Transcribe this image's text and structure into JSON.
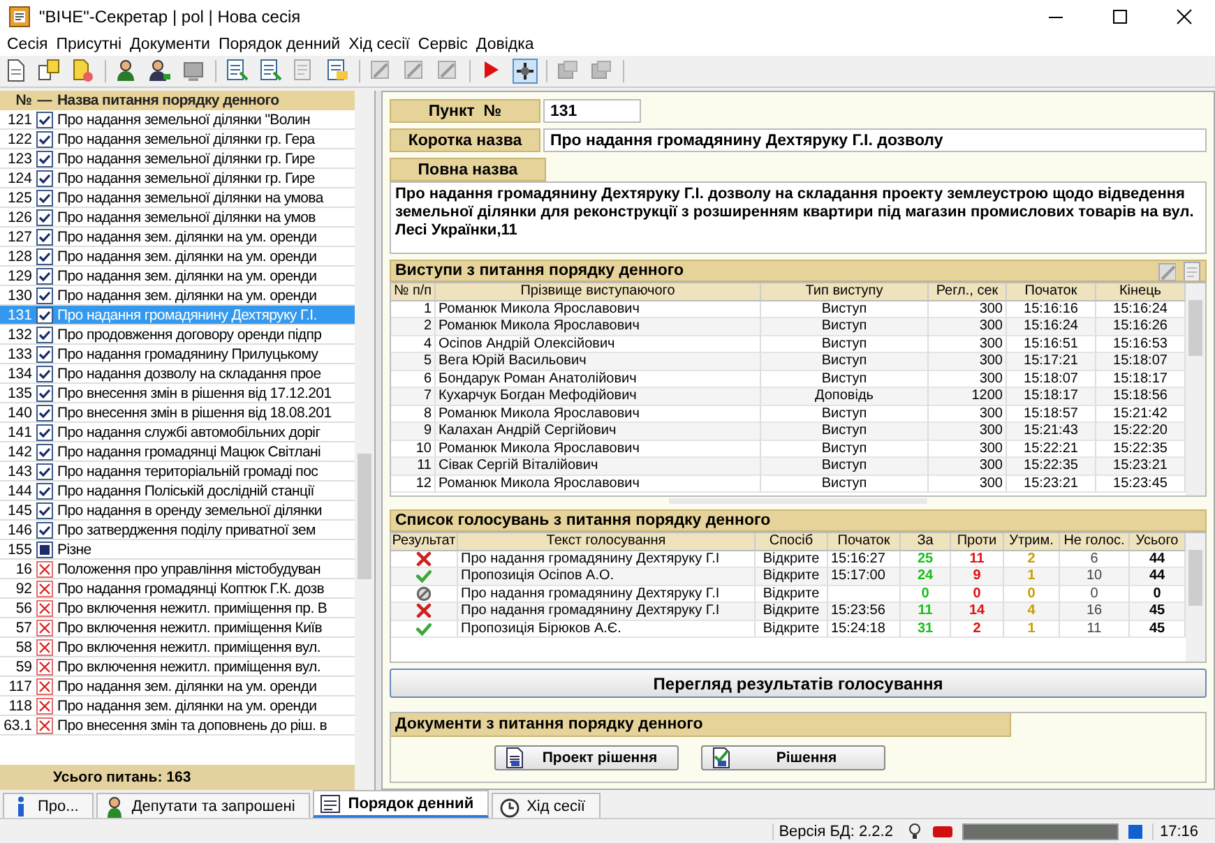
{
  "window": {
    "title": "\"ВІЧЕ\"-Секретар | pol | Нова сесія"
  },
  "menu": [
    "Сесія",
    "Присутні",
    "Документи",
    "Порядок денний",
    "Хід сесії",
    "Сервіс",
    "Довідка"
  ],
  "agenda": {
    "columns": [
      "№",
      "—",
      "Назва питання порядку денного"
    ],
    "items": [
      {
        "number": "121",
        "kind": "adopted",
        "selected": false,
        "title": "Про надання земельної ділянки \"Волин"
      },
      {
        "number": "122",
        "kind": "adopted",
        "selected": false,
        "title": "Про надання земельної ділянки гр. Гера"
      },
      {
        "number": "123",
        "kind": "adopted",
        "selected": false,
        "title": "Про надання земельної ділянки гр. Гире"
      },
      {
        "number": "124",
        "kind": "adopted",
        "selected": false,
        "title": "Про надання земельної ділянки гр. Гире"
      },
      {
        "number": "125",
        "kind": "adopted",
        "selected": false,
        "title": "Про надання земельної ділянки на умова"
      },
      {
        "number": "126",
        "kind": "adopted",
        "selected": false,
        "title": "Про надання земельної ділянки на умов"
      },
      {
        "number": "127",
        "kind": "adopted",
        "selected": false,
        "title": "Про надання зем. ділянки на ум. оренди"
      },
      {
        "number": "128",
        "kind": "adopted",
        "selected": false,
        "title": "Про надання зем. ділянки на ум. оренди"
      },
      {
        "number": "129",
        "kind": "adopted",
        "selected": false,
        "title": "Про надання зем. ділянки на ум. оренди"
      },
      {
        "number": "130",
        "kind": "adopted",
        "selected": false,
        "title": "Про надання зем. ділянки на ум. оренди"
      },
      {
        "number": "131",
        "kind": "adopted",
        "selected": true,
        "title": "Про надання громадянину Дехтяруку Г.І."
      },
      {
        "number": "132",
        "kind": "adopted",
        "selected": false,
        "title": "Про продовження договору оренди підпр"
      },
      {
        "number": "133",
        "kind": "adopted",
        "selected": false,
        "title": "Про надання громадянину Прилуцькому"
      },
      {
        "number": "134",
        "kind": "adopted",
        "selected": false,
        "title": "Про надання дозволу на складання прое"
      },
      {
        "number": "135",
        "kind": "adopted",
        "selected": false,
        "title": "Про внесення змін в рішення від 17.12.201"
      },
      {
        "number": "140",
        "kind": "adopted",
        "selected": false,
        "title": "Про внесення змін в рішення від 18.08.201"
      },
      {
        "number": "141",
        "kind": "adopted",
        "selected": false,
        "title": "Про надання службі автомобільних доріг"
      },
      {
        "number": "142",
        "kind": "adopted",
        "selected": false,
        "title": "Про надання громадянці Мацюк Світлані"
      },
      {
        "number": "143",
        "kind": "adopted",
        "selected": false,
        "title": "Про надання територіальній громаді пос"
      },
      {
        "number": "144",
        "kind": "adopted",
        "selected": false,
        "title": "Про надання Поліській дослідній станції"
      },
      {
        "number": "145",
        "kind": "adopted",
        "selected": false,
        "title": "Про надання в оренду земельної ділянки"
      },
      {
        "number": "146",
        "kind": "adopted",
        "selected": false,
        "title": "Про затвердження поділу приватної зем"
      },
      {
        "number": "155",
        "kind": "section",
        "selected": false,
        "title": "Різне"
      },
      {
        "number": "16",
        "kind": "rejected",
        "selected": false,
        "title": "Положення про управління містобудуван"
      },
      {
        "number": "92",
        "kind": "rejected",
        "selected": false,
        "title": "Про надання громадянці Коптюк Г.К. дозв"
      },
      {
        "number": "56",
        "kind": "rejected",
        "selected": false,
        "title": "Про включення нежитл. приміщення пр. В"
      },
      {
        "number": "57",
        "kind": "rejected",
        "selected": false,
        "title": "Про включення нежитл. приміщення Київ"
      },
      {
        "number": "58",
        "kind": "rejected",
        "selected": false,
        "title": "Про включення нежитл. приміщення вул."
      },
      {
        "number": "59",
        "kind": "rejected",
        "selected": false,
        "title": "Про включення нежитл. приміщення вул."
      },
      {
        "number": "117",
        "kind": "rejected",
        "selected": false,
        "title": "Про надання зем. ділянки на ум. оренди"
      },
      {
        "number": "118",
        "kind": "rejected",
        "selected": false,
        "title": "Про надання зем. ділянки на ум. оренди"
      },
      {
        "number": "63.1",
        "kind": "rejected",
        "selected": false,
        "title": "Про внесення змін та доповнень до ріш. в"
      }
    ],
    "total": "Усього питань: 163"
  },
  "item": {
    "number_label": "Пункт  №",
    "number": "131",
    "short_label": "Коротка назва",
    "short": "Про надання громадянину Дехтяруку Г.І. дозволу",
    "full_label": "Повна назва",
    "full": "Про надання громадянину Дехтяруку Г.І. дозволу на складання проекту землеустрою щодо відведення земельної ділянки для реконструкції з розширенням квартири під магазин промислових товарів на вул. Лесі Українки,11"
  },
  "speeches": {
    "title": "Виступи з питання порядку денного",
    "columns": [
      "№ п/п",
      "Прізвище виступаючого",
      "Тип виступу",
      "Регл., сек",
      "Початок",
      "Кінець"
    ],
    "rows": [
      [
        "1",
        "Романюк Микола Ярославович",
        "Виступ",
        "300",
        "15:16:16",
        "15:16:24"
      ],
      [
        "2",
        "Романюк Микола Ярославович",
        "Виступ",
        "300",
        "15:16:24",
        "15:16:26"
      ],
      [
        "4",
        "Осіпов Андрій Олексійович",
        "Виступ",
        "300",
        "15:16:51",
        "15:16:53"
      ],
      [
        "5",
        "Вега Юрій Васильович",
        "Виступ",
        "300",
        "15:17:21",
        "15:18:07"
      ],
      [
        "6",
        "Бондарук Роман Анатолійович",
        "Виступ",
        "300",
        "15:18:07",
        "15:18:17"
      ],
      [
        "7",
        "Кухарчук Богдан Мефодійович",
        "Доповідь",
        "1200",
        "15:18:17",
        "15:18:56"
      ],
      [
        "8",
        "Романюк Микола Ярославович",
        "Виступ",
        "300",
        "15:18:57",
        "15:21:42"
      ],
      [
        "9",
        "Калахан Андрій Сергійович",
        "Виступ",
        "300",
        "15:21:43",
        "15:22:20"
      ],
      [
        "10",
        "Романюк Микола Ярославович",
        "Виступ",
        "300",
        "15:22:21",
        "15:22:35"
      ],
      [
        "11",
        "Сівак Сергій Віталійович",
        "Виступ",
        "300",
        "15:22:35",
        "15:23:21"
      ],
      [
        "12",
        "Романюк Микола Ярославович",
        "Виступ",
        "300",
        "15:23:21",
        "15:23:45"
      ]
    ]
  },
  "votes": {
    "title": "Список голосувань з питання порядку денного",
    "result_column": "Результат",
    "columns": [
      "Текст голосування",
      "Спосіб",
      "Початок",
      "За",
      "Проти",
      "Утрим.",
      "Не голос.",
      "Усього"
    ],
    "rows": [
      {
        "kind": "rejected",
        "cells": [
          "Про надання громадянину Дехтяруку Г.І",
          "Відкрите",
          "15:16:27",
          "25",
          "11",
          "2",
          "6",
          "44"
        ]
      },
      {
        "kind": "adopted",
        "cells": [
          "Пропозиція Осіпов А.О.",
          "Відкрите",
          "15:17:00",
          "24",
          "9",
          "1",
          "10",
          "44"
        ]
      },
      {
        "kind": "cancelled",
        "cells": [
          "Про надання громадянину Дехтяруку Г.І",
          "Відкрите",
          null,
          "0",
          "0",
          "0",
          "0",
          "0"
        ]
      },
      {
        "kind": "rejected",
        "cells": [
          "Про надання громадянину Дехтяруку Г.І",
          "Відкрите",
          "15:23:56",
          "11",
          "14",
          "4",
          "16",
          "45"
        ]
      },
      {
        "kind": "adopted",
        "cells": [
          "Пропозиція Бірюков А.Є.",
          "Відкрите",
          "15:24:18",
          "31",
          "2",
          "1",
          "11",
          "45"
        ]
      }
    ]
  },
  "results_button": "Перегляд результатів голосування",
  "documents": {
    "title": "Документи з питання порядку денного",
    "buttons": [
      "Проект рішення",
      "Рішення"
    ]
  },
  "tabs": [
    {
      "label": "Про...",
      "selected": false
    },
    {
      "label": "Депутати та запрошені",
      "selected": false
    },
    {
      "label": "Порядок денний",
      "selected": true
    },
    {
      "label": "Хід сесії",
      "selected": false
    }
  ],
  "status_bar": {
    "version": "Версія БД: 2.2.2",
    "progress": {
      "level": 1
    },
    "time": "17:16"
  }
}
